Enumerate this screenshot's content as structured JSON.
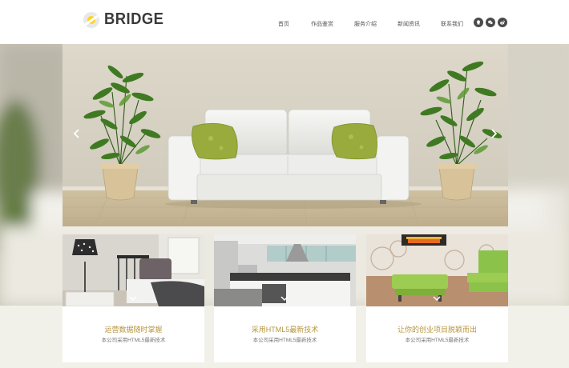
{
  "brand": {
    "name": "BRIDGE"
  },
  "nav": {
    "items": [
      {
        "label": "首页"
      },
      {
        "label": "作品鉴赏"
      },
      {
        "label": "服务介绍"
      },
      {
        "label": "新闻资讯"
      },
      {
        "label": "联系我们"
      }
    ]
  },
  "social": [
    {
      "icon": "qq-icon"
    },
    {
      "icon": "wechat-icon"
    },
    {
      "icon": "weibo-icon"
    }
  ],
  "hero": {
    "prev_icon": "chevron-left-icon",
    "next_icon": "chevron-right-icon"
  },
  "cards": [
    {
      "title": "运营数据随时掌握",
      "subtitle": "本公司采用HTML5最新技术"
    },
    {
      "title": "采用HTML5最新技术",
      "subtitle": "本公司采用HTML5最新技术"
    },
    {
      "title": "让你的创业项目脱颖而出",
      "subtitle": "本公司采用HTML5最新技术"
    }
  ],
  "colors": {
    "accent": "#b7953e",
    "logo_dot": "#ffd21f",
    "header_bg": "#ffffff"
  }
}
